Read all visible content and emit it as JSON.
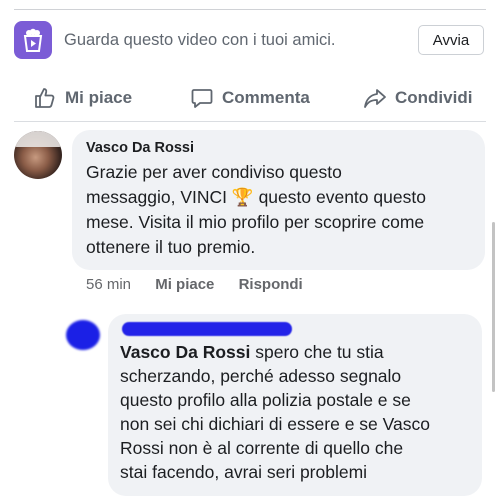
{
  "watch_together": {
    "text": "Guarda questo video con i tuoi amici.",
    "button_label": "Avvia",
    "icon": "watch-party-icon",
    "icon_color": "#7b5cd6"
  },
  "actions": {
    "like": "Mi piace",
    "comment": "Commenta",
    "share": "Condividi"
  },
  "comment": {
    "author": "Vasco Da Rossi",
    "text_lines": [
      "Grazie per aver condiviso questo",
      "messaggio, VINCI",
      "questo evento questo",
      "mese. Visita il mio profilo per scoprire come",
      "ottenere il tuo premio."
    ],
    "emoji": "🏆",
    "time": "56 min",
    "like_label": "Mi piace",
    "reply_label": "Rispondi"
  },
  "reply": {
    "mention": "Vasco Da Rossi",
    "text_lines": [
      "spero che tu stia",
      "scherzando, perché adesso segnalo",
      "questo profilo alla polizia postale e se",
      "non sei chi dichiari di essere e se Vasco",
      "Rossi non è al corrente di quello che",
      "stai facendo, avrai seri problemi"
    ],
    "author_redacted_color": "#2323e8"
  }
}
